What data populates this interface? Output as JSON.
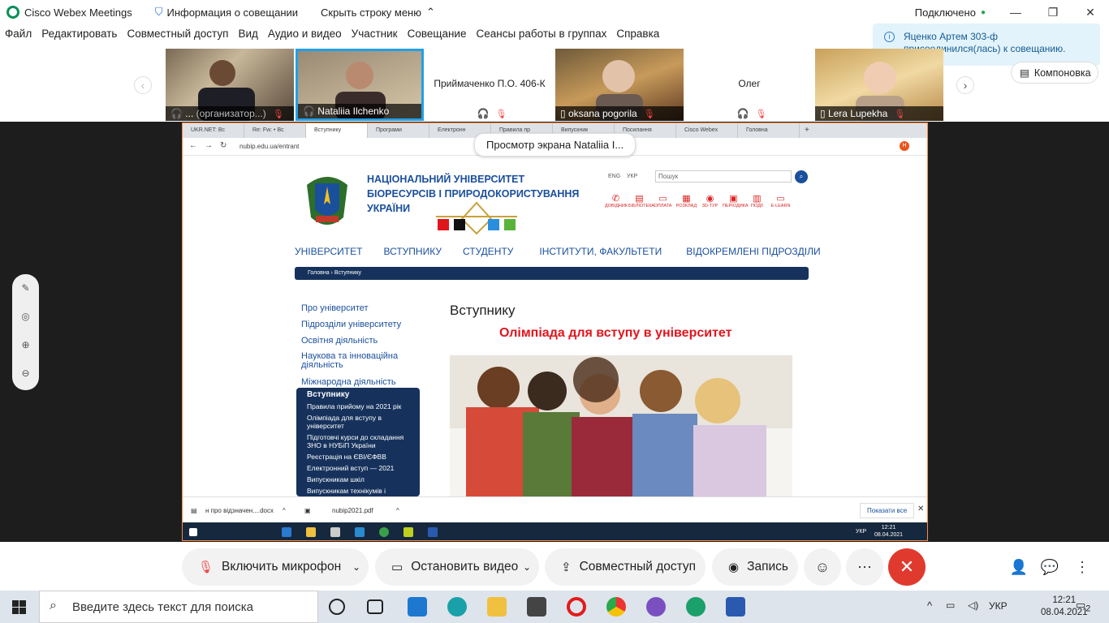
{
  "titlebar": {
    "app_name": "Cisco Webex Meetings",
    "info": "Информация о совещании",
    "hide_menu": "Скрыть строку меню",
    "chevron": "^",
    "status": "Подключено",
    "status_color": "#2aa34a"
  },
  "menu": [
    "Файл",
    "Редактировать",
    "Совместный доступ",
    "Вид",
    "Аудио и видео",
    "Участник",
    "Совещание",
    "Сеансы работы в группах",
    "Справка"
  ],
  "toast": {
    "line1": "Яценко Артем 303-ф",
    "line2": "присоединился(лась) к совещанию."
  },
  "participants": [
    {
      "name": "...",
      "role": "(организатор...)"
    },
    {
      "name": "Nataliia Ilchenko"
    },
    {
      "name": "Приймаченко П.О. 406-К"
    },
    {
      "name": "oksana pogorila"
    },
    {
      "name": "Олег"
    },
    {
      "name": "Lera Lupekha"
    }
  ],
  "layout_button": "Компоновка",
  "share_label": "Просмотр экрана Nataliia I...",
  "browser": {
    "tabs": [
      "UKR.NET: Вс",
      "Re: Fw: • Вс",
      "Вступнику",
      "Програми",
      "Електронн",
      "Правила пр",
      "Випускник",
      "Посилання",
      "Cisco Webex",
      "Головна"
    ],
    "url": "nubip.edu.ua/entrant",
    "profile_letter": "Н"
  },
  "site": {
    "title_line1": "НАЦІОНАЛЬНИЙ УНІВЕРСИТЕТ",
    "title_line2": "БІОРЕСУРСІВ І ПРИРОДОКОРИСТУВАННЯ",
    "title_line3": "УКРАЇНИ",
    "lang_en": "ENG",
    "lang_uk": "УКР",
    "search_placeholder": "Пошук",
    "quick_links": [
      "ДОВІДНИК",
      "БІБЛІОТЕКА",
      "ОПЛАТА",
      "РОЗКЛАД",
      "3D-ТУР",
      "ПЕРІОДИКА",
      "ПОДІЇ",
      "E-LEARN"
    ],
    "nav": [
      "УНІВЕРСИТЕТ",
      "ВСТУПНИКУ",
      "СТУДЕНТУ",
      "ІНСТИТУТИ, ФАКУЛЬТЕТИ",
      "ВІДОКРЕМЛЕНІ ПІДРОЗДІЛИ"
    ],
    "breadcrumb": "Головна › Вступнику",
    "left_menu": [
      "Про університет",
      "Підрозділи університету",
      "Освітня діяльність",
      "Наукова та інноваційна діяльність",
      "Міжнародна діяльність"
    ],
    "submenu_title": "Вступнику",
    "submenu": [
      "Правила прийому на 2021 рік",
      "Олімпіада для вступу в університет",
      "Підготовчі курси до складання ЗНО в НУБіП України",
      "Реєстрація на ЄВІ/ЄФВВ",
      "Електронний вступ — 2021",
      "Випускникам шкіл",
      "Випускникам технікумів і"
    ],
    "page_title": "Вступнику",
    "headline": "Олімпіада для вступу в університет",
    "headline_color": "#e1151c",
    "brand_color": "#1a4f9c"
  },
  "downloads": {
    "file1": "н про відзначен....docx",
    "file2": "nubip2021.pdf",
    "show_all": "Показати все"
  },
  "inner_taskbar": {
    "lang": "УКР",
    "time": "12:21",
    "date": "08.04.2021"
  },
  "controls": {
    "mic": "Включить микрофон",
    "video": "Остановить видео",
    "share": "Совместный доступ",
    "record": "Запись"
  },
  "taskbar": {
    "search_placeholder": "Введите здесь текст для поиска",
    "lang": "УКР",
    "time": "12:21",
    "date": "08.04.2021",
    "notifications": "2"
  }
}
